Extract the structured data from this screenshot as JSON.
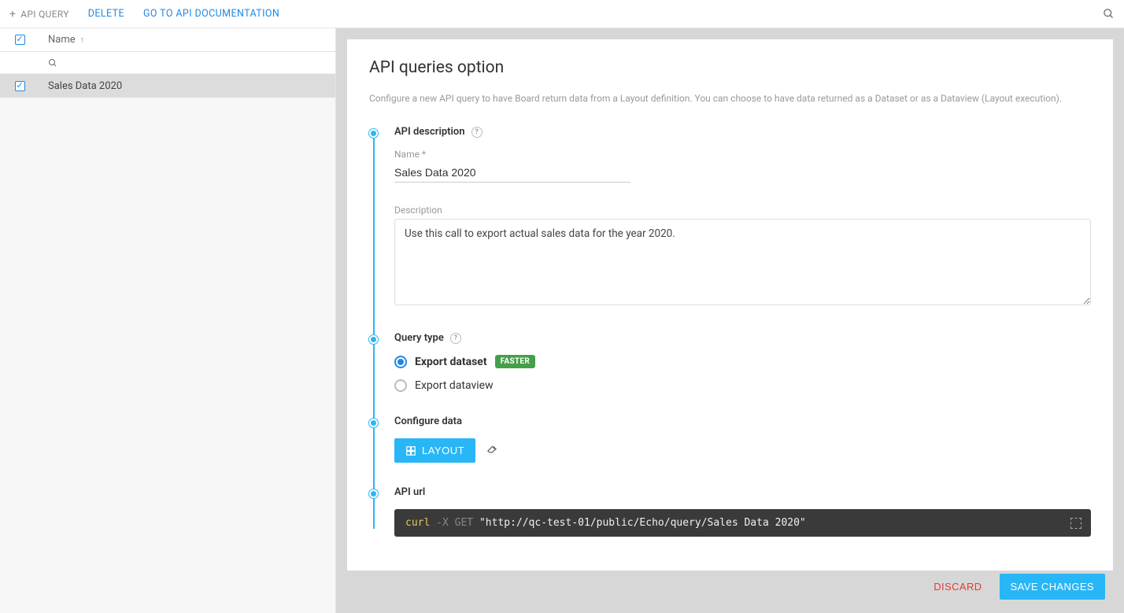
{
  "topbar": {
    "add_query_label": "API QUERY",
    "delete_label": "DELETE",
    "docs_label": "GO TO API DOCUMENTATION"
  },
  "sidebar": {
    "header_name_label": "Name",
    "items": [
      {
        "label": "Sales Data 2020",
        "checked": true
      }
    ]
  },
  "page": {
    "title": "API queries option",
    "description": "Configure a new API query to have Board return data from a Layout definition. You can choose to have data returned as a Dataset or as a Dataview (Layout execution)."
  },
  "steps": {
    "api_description": {
      "title": "API description",
      "name_label": "Name *",
      "name_value": "Sales Data 2020",
      "description_label": "Description",
      "description_value": "Use this call to export actual sales data for the year 2020."
    },
    "query_type": {
      "title": "Query type",
      "options": [
        {
          "label": "Export dataset",
          "selected": true,
          "badge": "FASTER"
        },
        {
          "label": "Export dataview",
          "selected": false
        }
      ]
    },
    "configure_data": {
      "title": "Configure data",
      "layout_button": "LAYOUT"
    },
    "api_url": {
      "title": "API url",
      "curl_cmd": "curl",
      "curl_flag": "-X",
      "curl_method": "GET",
      "curl_url": "\"http://qc-test-01/public/Echo/query/Sales Data 2020\""
    }
  },
  "footer": {
    "discard_label": "DISCARD",
    "save_label": "SAVE CHANGES"
  }
}
